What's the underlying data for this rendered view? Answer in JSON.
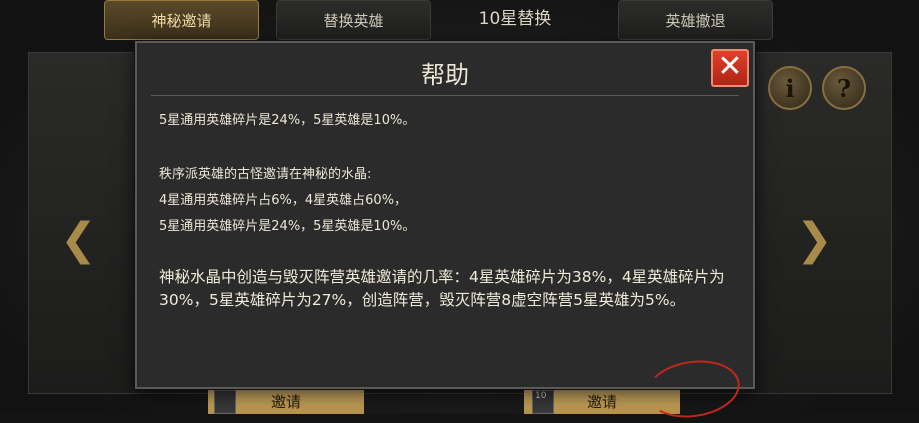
{
  "tabs": [
    {
      "label": "神秘邀请"
    },
    {
      "label": "替换英雄"
    },
    {
      "label": "10星替换"
    },
    {
      "label": "英雄撤退"
    }
  ],
  "invite_buttons": [
    {
      "label": "邀请"
    },
    {
      "label": "邀请"
    }
  ],
  "thumb_badges": [
    "10"
  ],
  "dialog": {
    "title": "帮助",
    "lines": [
      "5星通用英雄碎片是24%，5星英雄是10%。",
      "秩序派英雄的古怪邀请在神秘的水晶:",
      "4星通用英雄碎片占6%，4星英雄占60%，",
      "5星通用英雄碎片是24%，5星英雄是10%。"
    ],
    "paragraph": "神秘水晶中创造与毁灭阵营英雄邀请的几率：4星英雄碎片为38%，4星英雄碎片为30%，5星英雄碎片为27%，创造阵营，毁灭阵营8虚空阵营5星英雄为5%。"
  }
}
